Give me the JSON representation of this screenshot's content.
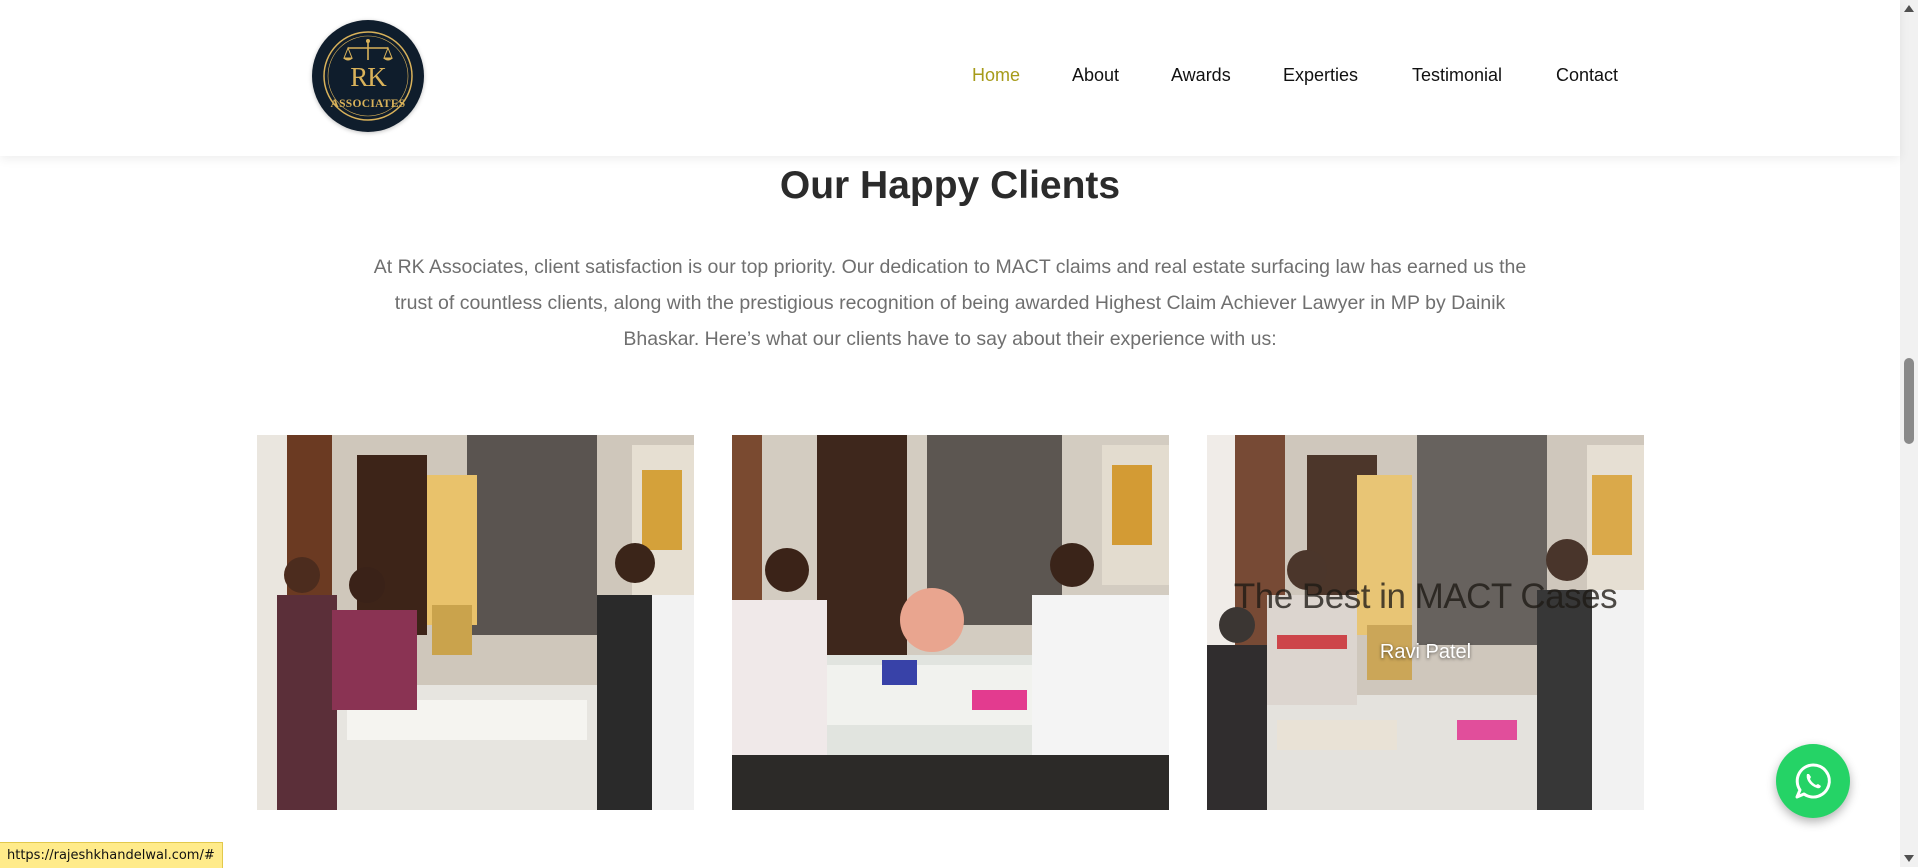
{
  "brand": {
    "logo_line1": "RK",
    "logo_line2": "ASSOCIATES",
    "logo_icon": "scales-of-justice-icon",
    "logo_bg": "#0f1d2c",
    "logo_gold": "#d9b25a"
  },
  "nav": {
    "items": [
      {
        "label": "Home",
        "active": true
      },
      {
        "label": "About",
        "active": false
      },
      {
        "label": "Awards",
        "active": false
      },
      {
        "label": "Experties",
        "active": false
      },
      {
        "label": "Testimonial",
        "active": false
      },
      {
        "label": "Contact",
        "active": false
      }
    ],
    "active_color": "#a69b19"
  },
  "section": {
    "title": "Our Happy Clients",
    "intro": "At RK Associates, client satisfaction is our top priority. Our dedication to MACT claims and real estate surfacing law has earned us the trust of countless clients, along with the prestigious recognition of being awarded Highest Claim Achiever Lawyer in MP by Dainik Bhaskar. Here’s what our clients have to say about their experience with us:"
  },
  "testimonials": [
    {
      "overlay_title": "",
      "client_name": ""
    },
    {
      "overlay_title": "",
      "client_name": ""
    },
    {
      "overlay_title": "The Best in MACT Cases",
      "client_name": "Ravi Patel"
    }
  ],
  "whatsapp": {
    "icon": "whatsapp-icon",
    "color": "#25d366"
  },
  "status_bar": {
    "url": "https://rajeshkhandelwal.com/#"
  }
}
